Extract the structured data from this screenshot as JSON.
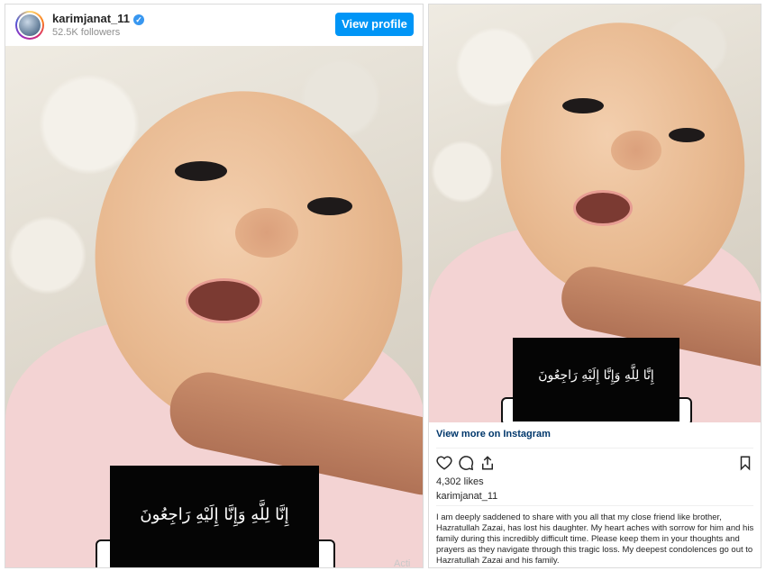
{
  "left_card": {
    "username": "karimjanat_11",
    "verified": true,
    "followers": "52.5K followers",
    "view_profile_label": "View profile",
    "overlay_text": "إِنَّا لِلَّهِ وَإِنَّا إِلَيْهِ رَاجِعُونَ"
  },
  "right_card": {
    "overlay_text": "إِنَّا لِلَّهِ وَإِنَّا إِلَيْهِ رَاجِعُونَ",
    "view_more_label": "View more on Instagram",
    "likes": "4,302 likes",
    "caption_user": "karimjanat_11",
    "caption": "I am deeply saddened to share with you all that my close friend like brother, Hazratullah Zazai, has lost his daughter. My heart aches with sorrow for him and his family during this incredibly difficult time. Please keep them in your thoughts and prayers as they navigate through this tragic loss. My deepest condolences go out to Hazratullah Zazai and his family.",
    "icons": [
      "heart-icon",
      "comment-icon",
      "share-icon",
      "bookmark-icon"
    ]
  },
  "watermark": "Acti",
  "colors": {
    "accent": "#0095f6",
    "link": "#00376b",
    "muted": "#8e8e8e"
  }
}
